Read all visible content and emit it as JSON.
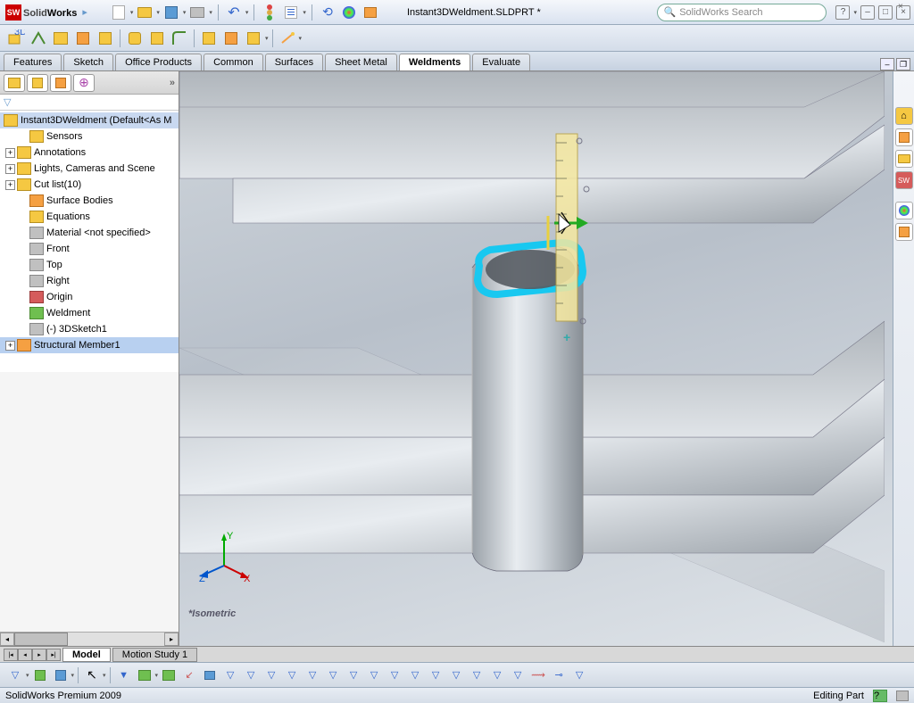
{
  "app": {
    "name_solid": "Solid",
    "name_works": "Works",
    "document": "Instant3DWeldment.SLDPRT *",
    "search_placeholder": "SolidWorks Search"
  },
  "ribbon": {
    "tabs": [
      "Features",
      "Sketch",
      "Office Products",
      "Common",
      "Surfaces",
      "Sheet Metal",
      "Weldments",
      "Evaluate"
    ],
    "active": "Weldments"
  },
  "tree": {
    "root": "Instant3DWeldment  (Default<As M",
    "items": [
      {
        "exp": "",
        "icon": "sensors-icon",
        "label": "Sensors",
        "pad": 20
      },
      {
        "exp": "+",
        "icon": "annotations-icon",
        "label": "Annotations",
        "pad": 6
      },
      {
        "exp": "+",
        "icon": "lights-icon",
        "label": "Lights, Cameras and Scene",
        "pad": 6
      },
      {
        "exp": "+",
        "icon": "cutlist-icon",
        "label": "Cut list(10)",
        "pad": 6
      },
      {
        "exp": "",
        "icon": "surface-bodies-icon",
        "label": "Surface Bodies",
        "pad": 20
      },
      {
        "exp": "",
        "icon": "equations-icon",
        "label": "Equations",
        "pad": 20
      },
      {
        "exp": "",
        "icon": "material-icon",
        "label": "Material <not specified>",
        "pad": 20
      },
      {
        "exp": "",
        "icon": "plane-icon",
        "label": "Front",
        "pad": 20
      },
      {
        "exp": "",
        "icon": "plane-icon",
        "label": "Top",
        "pad": 20
      },
      {
        "exp": "",
        "icon": "plane-icon",
        "label": "Right",
        "pad": 20
      },
      {
        "exp": "",
        "icon": "origin-icon",
        "label": "Origin",
        "pad": 20
      },
      {
        "exp": "",
        "icon": "weldment-icon",
        "label": "Weldment",
        "pad": 20
      },
      {
        "exp": "",
        "icon": "sketch3d-icon",
        "label": "(-) 3DSketch1",
        "pad": 20
      },
      {
        "exp": "+",
        "icon": "structural-member-icon",
        "label": "Structural Member1",
        "pad": 6,
        "sel": true
      }
    ]
  },
  "viewport": {
    "orientation": "*Isometric",
    "triad": {
      "x": "X",
      "y": "Y",
      "z": "Z"
    }
  },
  "bottom_tabs": {
    "active": "Model",
    "inactive": "Motion Study 1"
  },
  "status": {
    "left": "SolidWorks Premium 2009",
    "right": "Editing Part"
  }
}
